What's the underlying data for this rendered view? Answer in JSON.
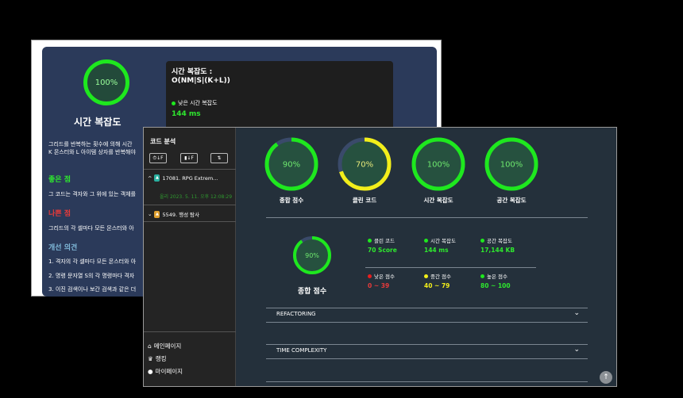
{
  "back": {
    "ring_value": "100%",
    "ring_title": "시간 복잡도",
    "panel_title": "시간 복잡도 :",
    "panel_formula": "O(NM|S|(K+L))",
    "panel_legend": "낮은 시간 복잡도",
    "panel_value": "144 ms",
    "desc_line1": "그리드를 반복하는 횟수에 의해 시간",
    "desc_line2": "K 몬스터와 L 아이템 상자를 반복해야",
    "good_title": "좋은 점",
    "good_text": "그 코드는 격자와 그 위에 있는 객체를",
    "bad_title": "나쁜 점",
    "bad_text": "그리드의 각 셀마다 모든 몬스터와 아",
    "improve_title": "개선 의견",
    "improve_1": "1. 격자의 각 셀마다 모든 몬스터와 아",
    "improve_2": "2. 명령 문자열 S의 각 명령마다 격자",
    "improve_3": "3. 이진 검색이나 보간 검색과 같은 더"
  },
  "sidebar": {
    "title": "코드 분석",
    "btn1": "⏱↓F",
    "btn2": "▮↓F",
    "btn3": "⇅",
    "item1": "17081. RPG Extrem...",
    "item1_date": "올리 2023. 5. 11. 오후 12:08:29",
    "item2": "5549. 행성 탐사",
    "nav_main": "메인페이지",
    "nav_rank": "랭킹",
    "nav_my": "마이페이지"
  },
  "rings": [
    {
      "value": "90%",
      "label": "종합 점수",
      "percent": 90,
      "color": "#1ee81e"
    },
    {
      "value": "70%",
      "label": "클린 코드",
      "percent": 70,
      "color": "#f2ee1a"
    },
    {
      "value": "100%",
      "label": "시간 복잡도",
      "percent": 100,
      "color": "#1ee81e"
    },
    {
      "value": "100%",
      "label": "공간 복잡도",
      "percent": 100,
      "color": "#1ee81e"
    }
  ],
  "summary": {
    "ring_value": "90%",
    "ring_percent": 90,
    "label": "종합 점수",
    "m1_label": "클린 코드",
    "m1_value": "70 Score",
    "m2_label": "시간 복잡도",
    "m2_value": "144 ms",
    "m3_label": "공간 복잡도",
    "m3_value": "17,144 KB",
    "l1_label": "낮은 점수",
    "l1_value": "0 ~ 39",
    "l2_label": "중간 점수",
    "l2_value": "40 ~ 79",
    "l3_label": "높은 점수",
    "l3_value": "80 ~ 100"
  },
  "accordions": {
    "a1": "REFACTORING",
    "a2": "TIME COMPLEXITY"
  },
  "scroll_top": "↑",
  "colors": {
    "green": "#1ee81e",
    "yellow": "#f2ee1a",
    "red": "#e81e1e",
    "track": "#3a4a6a"
  }
}
